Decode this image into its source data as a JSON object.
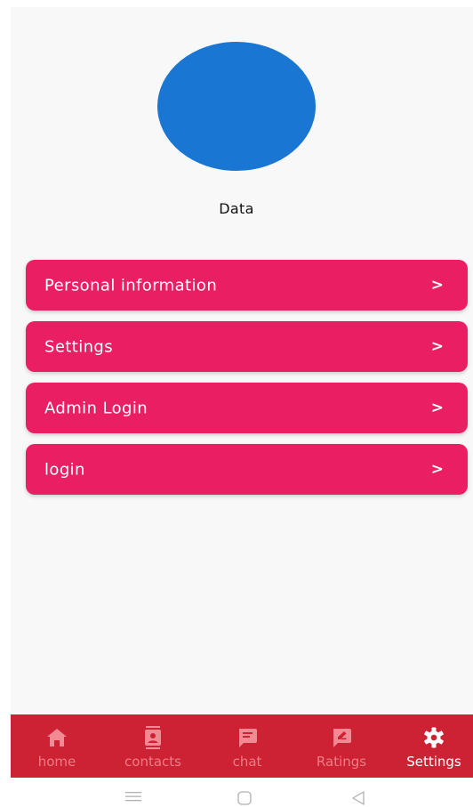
{
  "profile": {
    "name": "Data",
    "avatar_color": "#1976d2"
  },
  "menu": {
    "items": [
      {
        "label": "Personal information",
        "chevron": ">"
      },
      {
        "label": "Settings",
        "chevron": ">"
      },
      {
        "label": "Admin Login",
        "chevron": ">"
      },
      {
        "label": "login",
        "chevron": ">"
      }
    ],
    "item_color": "#e91e63"
  },
  "bottom_nav": {
    "background": "#cc2233",
    "items": [
      {
        "label": "home",
        "icon": "home-icon",
        "active": false
      },
      {
        "label": "contacts",
        "icon": "contacts-icon",
        "active": false
      },
      {
        "label": "chat",
        "icon": "chat-icon",
        "active": false
      },
      {
        "label": "Ratings",
        "icon": "ratings-icon",
        "active": false
      },
      {
        "label": "Settings",
        "icon": "gear-icon",
        "active": true
      }
    ]
  },
  "system_nav": {
    "buttons": [
      "menu-icon",
      "home-square-icon",
      "back-triangle-icon"
    ]
  }
}
